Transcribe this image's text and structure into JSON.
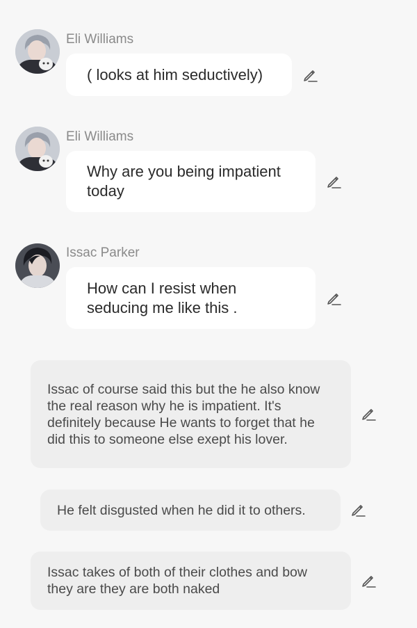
{
  "messages": [
    {
      "type": "character",
      "name": "Eli Williams",
      "avatar": "eli-avatar",
      "text": "( looks at him seductively)"
    },
    {
      "type": "character",
      "name": "Eli Williams",
      "avatar": "eli-avatar",
      "text": "Why are you being impatient today"
    },
    {
      "type": "character",
      "name": "Issac Parker",
      "avatar": "issac-avatar",
      "text": "How can I resist when seducing me like this ."
    },
    {
      "type": "narration",
      "text": "Issac of course said this but the he also know the real reason why he is impatient. It's definitely because He wants to forget that he did this to someone else exept his lover."
    },
    {
      "type": "narration",
      "text": "He felt disgusted when he did it to others."
    },
    {
      "type": "narration",
      "text": "Issac takes of both of their clothes and bow they are they are both naked"
    }
  ],
  "icons": {
    "edit": "pencil-icon"
  },
  "colors": {
    "background": "#f7f7f7",
    "bubble": "#ffffff",
    "narration_bubble": "#eeeeee",
    "sender_name": "#8a8a8a",
    "message_text": "#2a2a2a",
    "icon": "#555555"
  }
}
